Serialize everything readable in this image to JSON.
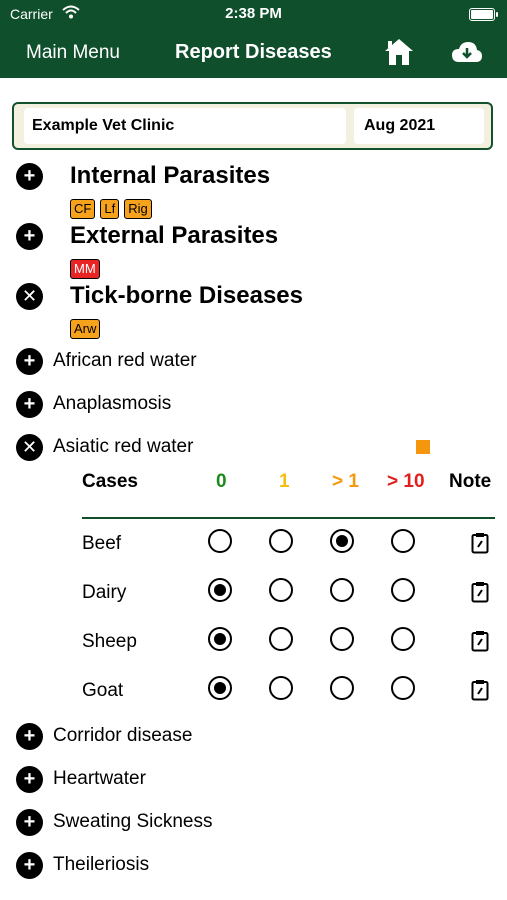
{
  "status": {
    "carrier": "Carrier",
    "time": "2:38 PM"
  },
  "nav": {
    "back": "Main Menu",
    "title": "Report Diseases"
  },
  "clinic": {
    "name": "Example Vet Clinic",
    "month": "Aug 2021"
  },
  "groups": [
    {
      "title": "Internal Parasites",
      "state": "collapsed",
      "badges": [
        "CF",
        "Lf",
        "Rig"
      ]
    },
    {
      "title": "External Parasites",
      "state": "collapsed",
      "badges": [
        "MM"
      ]
    },
    {
      "title": "Tick-borne Diseases",
      "state": "expanded",
      "badges": [
        "Arw"
      ]
    }
  ],
  "diseases": [
    {
      "name": "African red water",
      "state": "collapsed"
    },
    {
      "name": "Anaplasmosis",
      "state": "collapsed"
    },
    {
      "name": "Asiatic red water",
      "state": "expanded"
    },
    {
      "name": "Corridor disease",
      "state": "collapsed"
    },
    {
      "name": "Heartwater",
      "state": "collapsed"
    },
    {
      "name": "Sweating Sickness",
      "state": "collapsed"
    },
    {
      "name": "Theileriosis",
      "state": "collapsed"
    }
  ],
  "cases_table": {
    "headers": {
      "label": "Cases",
      "c0": "0",
      "c1": "1",
      "c2": "> 1",
      "c3": "> 10",
      "note": "Note"
    },
    "header_colors": {
      "c0": "#1e8a1e",
      "c1": "#f2c010",
      "c2": "#f29a10",
      "c3": "#e02020"
    },
    "rows": [
      {
        "species": "Beef",
        "selected": 2
      },
      {
        "species": "Dairy",
        "selected": 0
      },
      {
        "species": "Sheep",
        "selected": 0
      },
      {
        "species": "Goat",
        "selected": 0
      }
    ]
  },
  "colors": {
    "header_bg": "#0f4f2c",
    "badge_orange": "#f7a21c",
    "badge_red": "#e82424",
    "indicator": "#f5960f"
  }
}
